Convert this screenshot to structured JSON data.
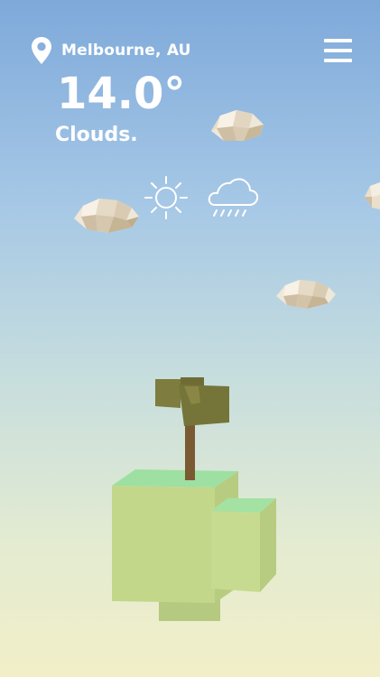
{
  "header": {
    "location": "Melbourne, AU",
    "temperature": "14.0°",
    "condition": "Clouds."
  },
  "icons": {
    "location": "map-pin-icon",
    "menu": "hamburger-menu-icon",
    "forecast": [
      "sun-icon",
      "rain-cloud-icon"
    ]
  },
  "colors": {
    "sky_top": "#7ea9da",
    "sky_bottom": "#f2efc8",
    "text": "#ffffff",
    "grass_top": "#9fe3a4",
    "block": "#c2d78a",
    "trunk": "#7a5a33",
    "canopy": "#7c7a3e"
  }
}
